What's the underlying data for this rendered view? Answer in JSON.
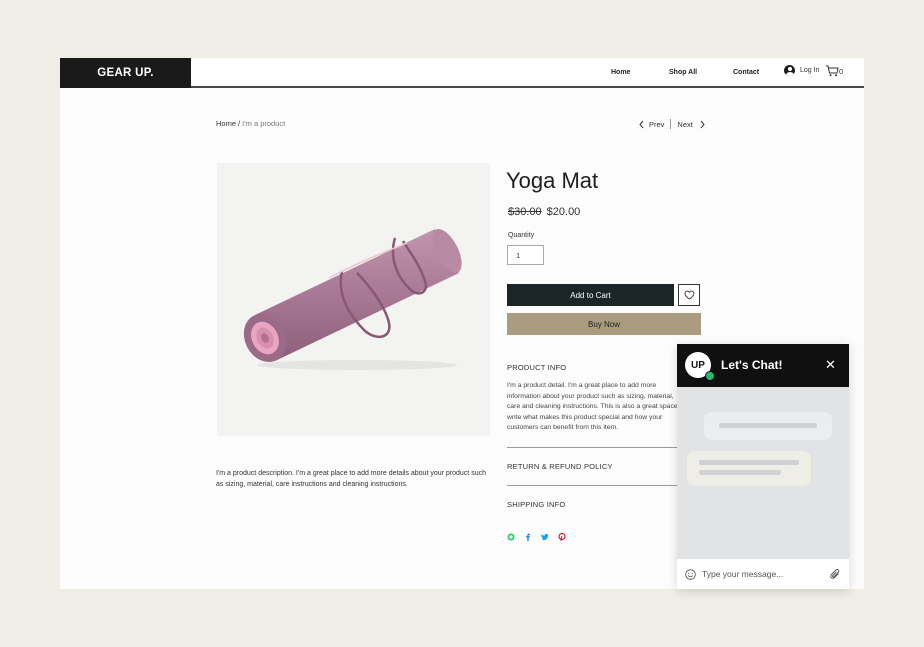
{
  "header": {
    "logo": "GEAR UP.",
    "nav": {
      "home": "Home",
      "shop_all": "Shop All",
      "contact": "Contact"
    },
    "login": "Log In",
    "cart_count": "0"
  },
  "breadcrumb": {
    "home": "Home",
    "separator": "/",
    "current": "I'm a product"
  },
  "pager": {
    "prev": "Prev",
    "next": "Next"
  },
  "product": {
    "title": "Yoga Mat",
    "old_price": "$30.00",
    "price": "$20.00",
    "quantity_label": "Quantity",
    "quantity_value": "1",
    "add_to_cart": "Add to Cart",
    "buy_now": "Buy Now",
    "description": "I'm a product description. I'm a great place to add more details about your product such as sizing, material, care instructions and cleaning instructions.",
    "image_icon": "yoga-mat-image"
  },
  "sections": {
    "product_info": "PRODUCT INFO",
    "product_info_text": "I'm a product detail. I'm a great place to add more information about your product such as sizing, material, care and cleaning instructions. This is also a great space to write what makes this product special and how your customers can benefit from this item.",
    "return_policy": "RETURN & REFUND POLICY",
    "shipping_info": "SHIPPING INFO"
  },
  "social": [
    "whatsapp-icon",
    "facebook-icon",
    "twitter-icon",
    "pinterest-icon"
  ],
  "chat": {
    "avatar": "UP",
    "title": "Let's Chat!",
    "input_placeholder": "Type your message..."
  },
  "colors": {
    "background": "#f0ede6",
    "add_to_cart": "#1c2527",
    "buy_now": "#a89b7e",
    "online": "#2bb673",
    "mat": "#a87894"
  }
}
